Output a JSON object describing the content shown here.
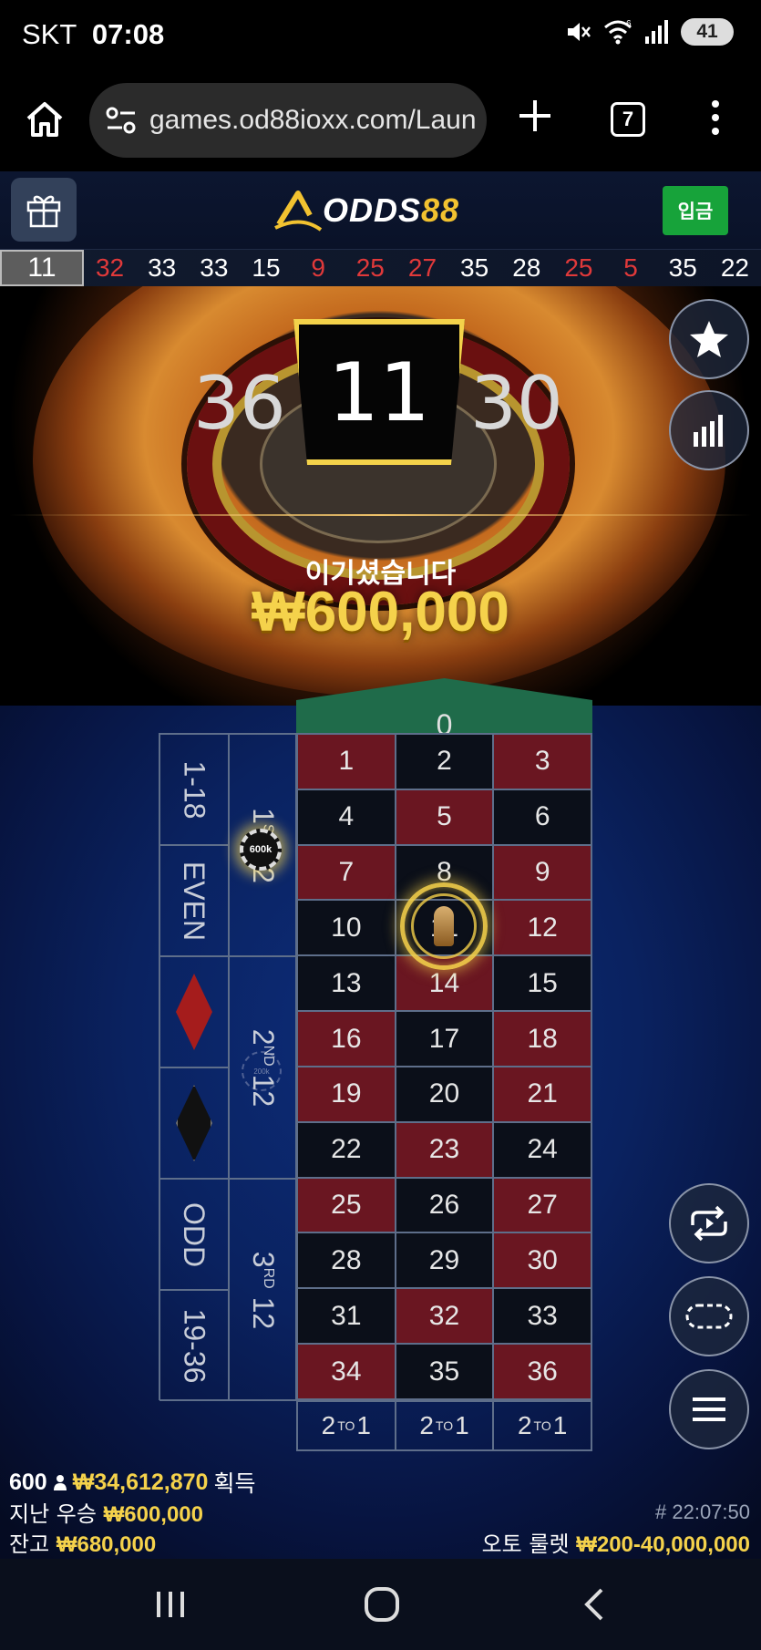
{
  "status": {
    "carrier": "SKT",
    "time": "07:08",
    "battery": "41",
    "wifi_badge": "6"
  },
  "browser": {
    "url": "games.od88ioxx.com/Laun",
    "tab_count": "7"
  },
  "header": {
    "logo_primary": "ODDS",
    "logo_secondary": "88",
    "deposit_label": "입금"
  },
  "history": {
    "latest": "11",
    "results": [
      {
        "n": "32",
        "c": "red"
      },
      {
        "n": "33",
        "c": "white"
      },
      {
        "n": "33",
        "c": "white"
      },
      {
        "n": "15",
        "c": "white"
      },
      {
        "n": "9",
        "c": "red"
      },
      {
        "n": "25",
        "c": "red"
      },
      {
        "n": "27",
        "c": "red"
      },
      {
        "n": "35",
        "c": "white"
      },
      {
        "n": "28",
        "c": "white"
      },
      {
        "n": "25",
        "c": "red"
      },
      {
        "n": "5",
        "c": "red"
      },
      {
        "n": "35",
        "c": "white"
      },
      {
        "n": "22",
        "c": "white"
      }
    ]
  },
  "wheel": {
    "left_number": "36",
    "winning_number": "11",
    "right_number": "30"
  },
  "win": {
    "label": "이기셨습니다",
    "amount": "₩600,000"
  },
  "table": {
    "zero": "0",
    "numbers": [
      {
        "n": "1",
        "c": "red"
      },
      {
        "n": "2",
        "c": "black"
      },
      {
        "n": "3",
        "c": "red"
      },
      {
        "n": "4",
        "c": "black"
      },
      {
        "n": "5",
        "c": "red"
      },
      {
        "n": "6",
        "c": "black"
      },
      {
        "n": "7",
        "c": "red"
      },
      {
        "n": "8",
        "c": "black"
      },
      {
        "n": "9",
        "c": "red"
      },
      {
        "n": "10",
        "c": "black"
      },
      {
        "n": "11",
        "c": "black"
      },
      {
        "n": "12",
        "c": "red"
      },
      {
        "n": "13",
        "c": "black"
      },
      {
        "n": "14",
        "c": "red"
      },
      {
        "n": "15",
        "c": "black"
      },
      {
        "n": "16",
        "c": "red"
      },
      {
        "n": "17",
        "c": "black"
      },
      {
        "n": "18",
        "c": "red"
      },
      {
        "n": "19",
        "c": "red"
      },
      {
        "n": "20",
        "c": "black"
      },
      {
        "n": "21",
        "c": "red"
      },
      {
        "n": "22",
        "c": "black"
      },
      {
        "n": "23",
        "c": "red"
      },
      {
        "n": "24",
        "c": "black"
      },
      {
        "n": "25",
        "c": "red"
      },
      {
        "n": "26",
        "c": "black"
      },
      {
        "n": "27",
        "c": "red"
      },
      {
        "n": "28",
        "c": "black"
      },
      {
        "n": "29",
        "c": "black"
      },
      {
        "n": "30",
        "c": "red"
      },
      {
        "n": "31",
        "c": "black"
      },
      {
        "n": "32",
        "c": "red"
      },
      {
        "n": "33",
        "c": "black"
      },
      {
        "n": "34",
        "c": "red"
      },
      {
        "n": "35",
        "c": "black"
      },
      {
        "n": "36",
        "c": "red"
      }
    ],
    "columns": [
      {
        "a": "2",
        "sup": "TO",
        "b": "1"
      },
      {
        "a": "2",
        "sup": "TO",
        "b": "1"
      },
      {
        "a": "2",
        "sup": "TO",
        "b": "1"
      }
    ],
    "outside": {
      "low": "1-18",
      "even": "EVEN",
      "odd": "ODD",
      "high": "19-36",
      "dozen1_num": "1",
      "dozen1_sup": "ST",
      "dozen1_12": "12",
      "dozen2_num": "2",
      "dozen2_sup": "ND",
      "dozen2_12": "12",
      "dozen3_num": "3",
      "dozen3_sup": "RD",
      "dozen3_12": "12"
    },
    "chips": {
      "dozen1_chip": "600k",
      "ghost_chip": "200k"
    }
  },
  "info": {
    "players": "600",
    "total_won": "₩34,612,870",
    "won_label": "획득",
    "last_win_label": "지난 우승",
    "last_win_value": "₩600,000",
    "balance_label": "잔고",
    "balance_value": "₩680,000",
    "round_time": "# 22:07:50",
    "game_name": "오토 룰렛",
    "limits": "₩200-40,000,000"
  },
  "colors": {
    "red_cell": "#6a1621",
    "black_cell": "#0b0f19",
    "gold": "#f5d24b",
    "zero_green": "#1f6b4a",
    "deposit_green": "#17a33a",
    "history_red": "#e0393a"
  }
}
